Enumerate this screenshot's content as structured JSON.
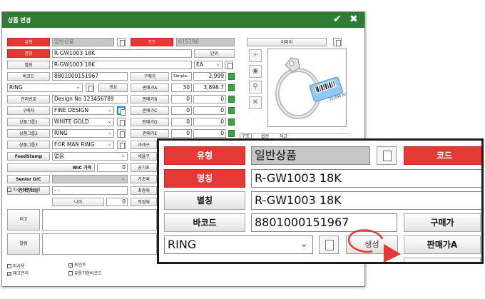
{
  "dialog": {
    "title": "상품 변경",
    "confirm_icon": "✔",
    "close_icon": "✖"
  },
  "left": {
    "type_label": "유형",
    "type_value": "일반상품",
    "code_label": "코드",
    "code_value": "015196",
    "name_label": "명칭",
    "name_value": "R-GW1003 18K",
    "unit_label": "단위",
    "unit_value": "EA",
    "alias_label": "별칭",
    "alias_value": "R-GW1003 18K",
    "barcode_label": "바코드",
    "barcode_value": "8801000151967",
    "purchase_label": "구매가",
    "purchase_mode": "Simple",
    "purchase_value": "2,999",
    "category_value": "RING",
    "generate_label": "생성",
    "sellA_label": "판매가A",
    "sellA_qty": "30",
    "sellA_value": "3,898.7",
    "mgmt_label": "관리번호",
    "mgmt_value": "Design No 123456789",
    "sellB_label": "판매가B",
    "sellB_qty": "0",
    "sellB_value": "0",
    "buyer_label": "구매처",
    "buyer_value": "FINE DESIGN",
    "sellC_label": "판매가C",
    "sellC_qty": "0",
    "sellC_value": "0",
    "group1_label": "상품그룹1",
    "group1_value": "WHITE GOLD",
    "sellD_label": "판매가D",
    "sellD_qty": "0",
    "sellD_value": "0",
    "group2_label": "상품그룹2",
    "group2_value": "RING",
    "sellE_label": "판매가E",
    "sellE_qty": "0",
    "sellE_value": "0",
    "group3_label": "상품그룹3",
    "group3_value": "FOR MAN RING",
    "tax_label": "과세구",
    "foodstamp_label": "FoodStamp",
    "foodstamp_value": "없음",
    "tax2_label": "세율구",
    "wic_label": "WIC 가격",
    "wic_value": "0",
    "public_label": "공기포",
    "senior_label": "Senior D/C",
    "base_label": "기초재",
    "sale_end_label": "판매종료일",
    "sale_end_value": "- -",
    "final_label": "최종재",
    "noprohibit_label": "미성년판매금지",
    "age_label": "나이",
    "age_value": "0",
    "proper_label": "적정재",
    "note_label": "비고",
    "alarm_label": "알림",
    "chk_unused": "미사용",
    "chk_point": "포인트",
    "chk_stock": "재고관리",
    "chk_expiry": "유통기한바코드"
  },
  "image_panel": {
    "title": "이미지",
    "tabs": [
      "구조",
      "옵션",
      "자고"
    ],
    "tag_price": "$2,898.60"
  },
  "zoom": {
    "type_label": "유형",
    "type_value": "일반상품",
    "code_label": "코드",
    "name_label": "명칭",
    "name_value": "R-GW1003 18K",
    "alias_label": "별칭",
    "alias_value": "R-GW1003 18K",
    "barcode_label": "바코드",
    "barcode_value": "8801000151967",
    "purchase_label": "구매가",
    "category_value": "RING",
    "generate_label": "생성",
    "sellA_label": "판매가A"
  },
  "colors": {
    "title_bar": "#2e7d32",
    "required_label": "#e53935",
    "annotation": "#e53935"
  }
}
